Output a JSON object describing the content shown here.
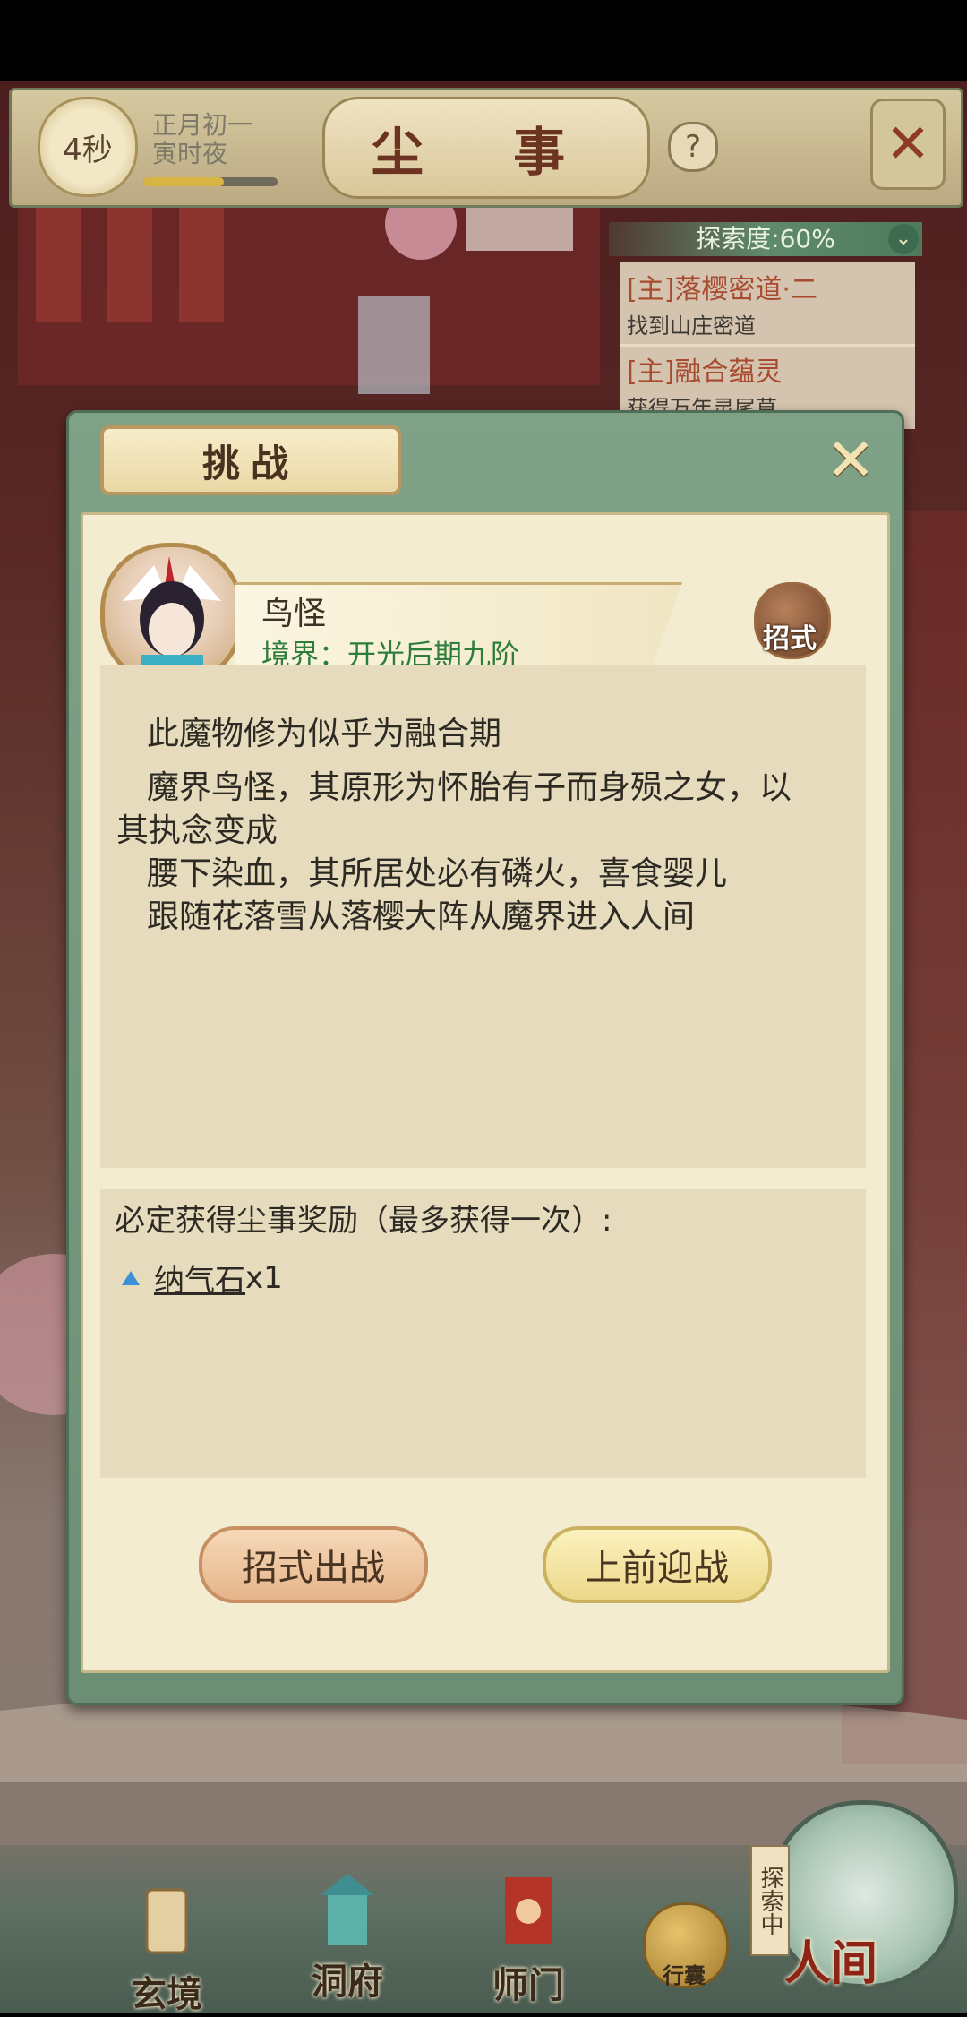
{
  "header": {
    "timer": "4秒",
    "date": "正月初一",
    "time_of_day": "寅时夜",
    "title": "尘 事",
    "help": "?",
    "close": "✕",
    "progress": 0.6
  },
  "quests": {
    "exploration": "探索度:60%",
    "items": [
      {
        "title": "[主]落樱密道·二",
        "desc": "找到山庄密道"
      },
      {
        "title": "[主]融合蕴灵",
        "desc": "获得万年灵尾草"
      }
    ]
  },
  "dialog": {
    "tab_title": "挑战",
    "close": "✕",
    "monster": {
      "name": "鸟怪",
      "realm": "境界：开光后期九阶"
    },
    "moves_label": "招式",
    "description": [
      "此魔物修为似乎为融合期",
      "魔界鸟怪，其原形为怀胎有子而身殒之女，以",
      "其执念变成",
      "腰下染血，其所居处必有磷火，喜食婴儿",
      "跟随花落雪从落樱大阵从魔界进入人间"
    ],
    "reward_header": "必定获得尘事奖励（最多获得一次）:",
    "reward": {
      "name": "纳气石",
      "qty": "x1"
    },
    "buttons": {
      "moves": "招式出战",
      "fight": "上前迎战"
    }
  },
  "nav": {
    "items": [
      "玄境",
      "洞府",
      "师门"
    ],
    "bag": "行囊",
    "world": "人间",
    "exploring": "探索中"
  },
  "colors": {
    "accent_green": "#2f7d3b",
    "quest_red": "#a74a2e",
    "gem_blue": "#3a8fd6"
  }
}
